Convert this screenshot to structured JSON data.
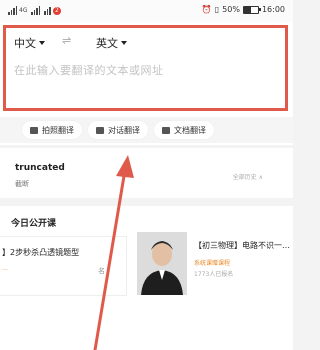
{
  "status_bar": {
    "signal_text": "4G",
    "notification_count": "2",
    "battery_percent": "50%",
    "battery_level": 0.5,
    "time": "16:00"
  },
  "translator": {
    "source_lang": "中文",
    "target_lang": "英文",
    "input_placeholder": "在此输入要翻译的文本或网址"
  },
  "actions": {
    "photo": "拍照翻译",
    "dialog": "对话翻译",
    "document": "文档翻译"
  },
  "history": {
    "title": "truncated",
    "subtitle": "截断",
    "more": "全部历史 ∧"
  },
  "courses": {
    "section_title": "今日公开课",
    "course1": {
      "title": "】2步秒杀凸透镜题型",
      "tag": "…",
      "action": "名"
    },
    "course2": {
      "title": "【初三物理】电路不识一…",
      "tag": "系统课赠课程",
      "count": "1773人已报名"
    }
  },
  "colors": {
    "annotation_red": "#e05a4c",
    "accent_orange": "#e88a2a"
  }
}
